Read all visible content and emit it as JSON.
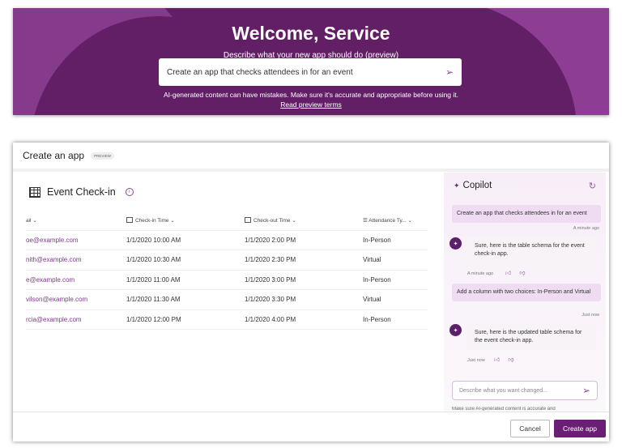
{
  "banner": {
    "title": "Welcome, Service",
    "subtitle": "Describe what your new app should do (preview)",
    "input_value": "Create an app that checks attendees in for an event",
    "disclaimer": "AI-generated content can have mistakes. Make sure it's accurate and appropriate before using it.",
    "terms_link": "Read preview terms"
  },
  "panel": {
    "title": "Create an app",
    "badge": "PREVIEW",
    "table_title": "Event Check-in",
    "columns": [
      "ail",
      "Check-in Time",
      "Check-out Time",
      "Attendance Ty..."
    ],
    "rows": [
      [
        "oe@example.com",
        "1/1/2020 10:00 AM",
        "1/1/2020 2:00 PM",
        "In-Person"
      ],
      [
        "nith@example.com",
        "1/1/2020 10:30 AM",
        "1/1/2020 2:30 PM",
        "Virtual"
      ],
      [
        "e@example.com",
        "1/1/2020 11:00 AM",
        "1/1/2020 3:00 PM",
        "In-Person"
      ],
      [
        "vilson@example.com",
        "1/1/2020 11:30 AM",
        "1/1/2020 3:30 PM",
        "Virtual"
      ],
      [
        "rcia@example.com",
        "1/1/2020 12:00 PM",
        "1/1/2020 4:00 PM",
        "In-Person"
      ]
    ]
  },
  "copilot": {
    "title": "Copilot",
    "messages": [
      {
        "role": "user",
        "text": "Create an app that checks attendees in for an event",
        "time": "A minute ago"
      },
      {
        "role": "bot",
        "text": "Sure, here is the table schema for the event check-in app.",
        "time": "A minute ago"
      },
      {
        "role": "user",
        "text": "Add a column with two choices: In-Person and Virtual",
        "time": "Just now"
      },
      {
        "role": "bot",
        "text": "Sure, here is the updated table schema for the event check-in app.",
        "time": "Just now"
      }
    ],
    "input_placeholder": "Describe what you want changed...",
    "note": "Make sure AI-generated content is accurate and"
  },
  "footer": {
    "cancel": "Cancel",
    "create": "Create app"
  },
  "colors": {
    "brand": "#6b1f74",
    "banner": "#621f66"
  }
}
